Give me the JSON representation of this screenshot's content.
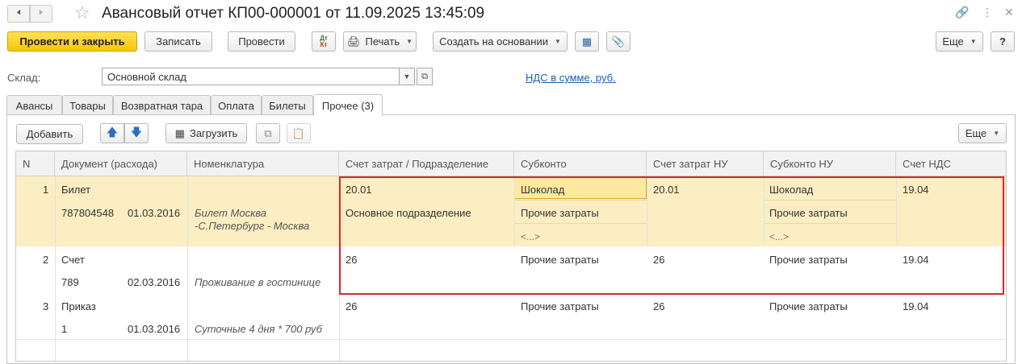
{
  "window": {
    "title": "Авансовый отчет КП00-000001 от 11.09.2025 13:45:09"
  },
  "toolbar": {
    "post_close": "Провести и закрыть",
    "save": "Записать",
    "post": "Провести",
    "dtkt": "Дт Кт",
    "print": "Печать",
    "create_based": "Создать на основании",
    "more": "Еще",
    "help": "?"
  },
  "form": {
    "warehouse_label": "Склад:",
    "warehouse_value": "Основной склад",
    "vat_link": "НДС в сумме, руб."
  },
  "tabs": [
    {
      "label": "Авансы"
    },
    {
      "label": "Товары"
    },
    {
      "label": "Возвратная тара"
    },
    {
      "label": "Оплата"
    },
    {
      "label": "Билеты"
    },
    {
      "label": "Прочее (3)"
    }
  ],
  "panel_toolbar": {
    "add": "Добавить",
    "load": "Загрузить",
    "more": "Еще"
  },
  "grid": {
    "columns": [
      "N",
      "Документ (расхода)",
      "Номенклатура",
      "Счет затрат / Подразделение",
      "Субконто",
      "Счет затрат НУ",
      "Субконто НУ",
      "Счет НДС"
    ],
    "rows": [
      {
        "n": "1",
        "doc_type": "Билет",
        "doc_number": "787804548",
        "doc_date": "01.03.2016",
        "nomenclature_1": "Билет Москва",
        "nomenclature_2": "-С.Петербург - Москва",
        "account": "20.01",
        "division": "Основное подразделение",
        "subconto_1": "Шоколад",
        "subconto_2": "Прочие затраты",
        "subconto_3": "<...>",
        "account_nu": "20.01",
        "subconto_nu_1": "Шоколад",
        "subconto_nu_2": "Прочие затраты",
        "subconto_nu_3": "<...>",
        "vat_account": "19.04"
      },
      {
        "n": "2",
        "doc_type": "Счет",
        "doc_number": "789",
        "doc_date": "02.03.2016",
        "nomenclature_1": "Проживание в гостинице",
        "account": "26",
        "subconto_1": "Прочие затраты",
        "account_nu": "26",
        "subconto_nu_1": "Прочие затраты",
        "vat_account": "19.04"
      },
      {
        "n": "3",
        "doc_type": "Приказ",
        "doc_number": "1",
        "doc_date": "01.03.2016",
        "nomenclature_1": "Суточные 4 дня * 700 руб",
        "account": "26",
        "subconto_1": "Прочие затраты",
        "account_nu": "26",
        "subconto_nu_1": "Прочие затраты",
        "vat_account": "19.04"
      }
    ]
  },
  "colors": {
    "primary_button": "#f6c800",
    "selected_row": "#fbeec2",
    "highlight_border": "#d9262e",
    "link": "#1a5fb4"
  }
}
